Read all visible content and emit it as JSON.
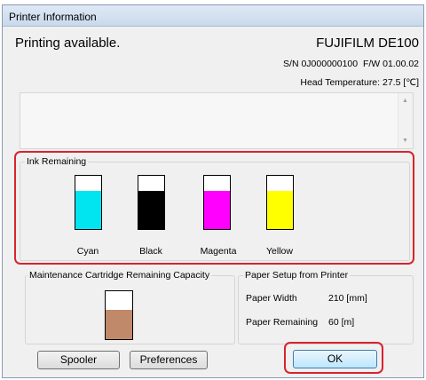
{
  "window": {
    "title": "Printer Information"
  },
  "status": {
    "message": "Printing available.",
    "model": "FUJIFILM DE100",
    "serial": "S/N 0J000000100",
    "firmware": "F/W 01.00.02",
    "head_temperature_label": "Head Temperature:",
    "head_temperature_value": "27.5",
    "head_temperature_unit": "[℃]"
  },
  "ink": {
    "title": "Ink Remaining",
    "cartridges": [
      {
        "label": "Cyan",
        "color": "#00e5ef",
        "level": 0.72
      },
      {
        "label": "Black",
        "color": "#000000",
        "level": 0.72
      },
      {
        "label": "Magenta",
        "color": "#ff00ff",
        "level": 0.72
      },
      {
        "label": "Yellow",
        "color": "#ffff00",
        "level": 0.72
      }
    ]
  },
  "maintenance": {
    "title": "Maintenance Cartridge Remaining Capacity",
    "color": "#c08a6a",
    "level": 0.62
  },
  "paper": {
    "title": "Paper Setup from Printer",
    "width_label": "Paper Width",
    "width_value": "210 [mm]",
    "remaining_label": "Paper Remaining",
    "remaining_value": "60 [m]"
  },
  "buttons": {
    "spooler": "Spooler",
    "preferences": "Preferences",
    "ok": "OK"
  },
  "colors": {
    "highlight": "#d9232d"
  }
}
